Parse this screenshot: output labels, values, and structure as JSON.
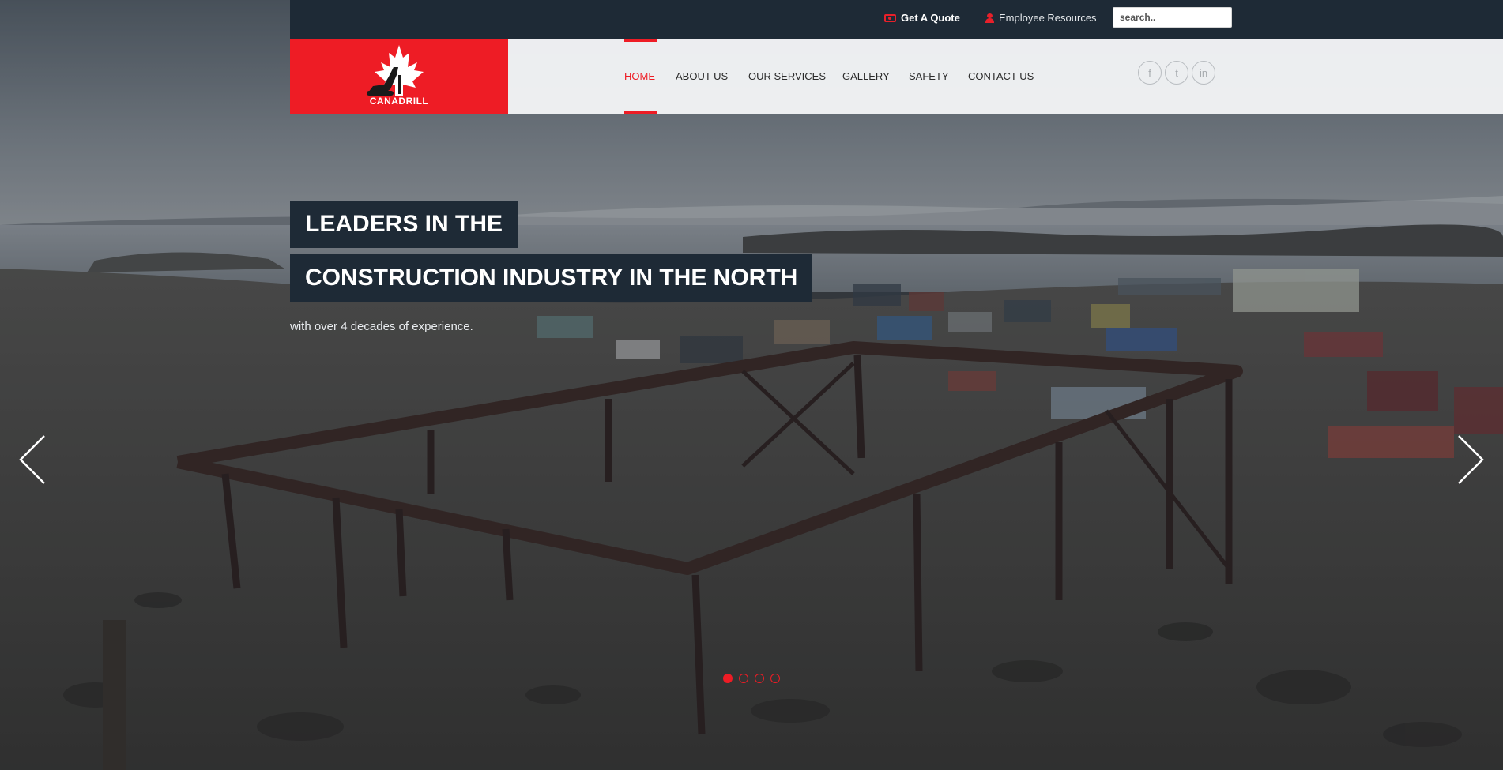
{
  "topbar": {
    "quote_label": "Get A Quote",
    "employee_label": "Employee Resources",
    "search_placeholder": "search.."
  },
  "brand": {
    "name": "CANADRILL",
    "accent_color": "#ee1c25",
    "dark_color": "#1e2a36"
  },
  "nav": {
    "items": [
      {
        "label": "HOME",
        "active": true
      },
      {
        "label": "ABOUT US",
        "active": false
      },
      {
        "label": "OUR SERVICES",
        "active": false
      },
      {
        "label": "GALLERY",
        "active": false
      },
      {
        "label": "SAFETY",
        "active": false
      },
      {
        "label": "CONTACT US",
        "active": false
      }
    ]
  },
  "social": [
    {
      "icon": "facebook-icon",
      "glyph": "f"
    },
    {
      "icon": "twitter-icon",
      "glyph": "t"
    },
    {
      "icon": "linkedin-icon",
      "glyph": "in"
    }
  ],
  "hero": {
    "headline_line1": "LEADERS IN THE",
    "headline_line2": "CONSTRUCTION INDUSTRY IN THE NORTH",
    "subline": "with over 4 decades of experience.",
    "slides": 4,
    "active_slide": 1
  }
}
